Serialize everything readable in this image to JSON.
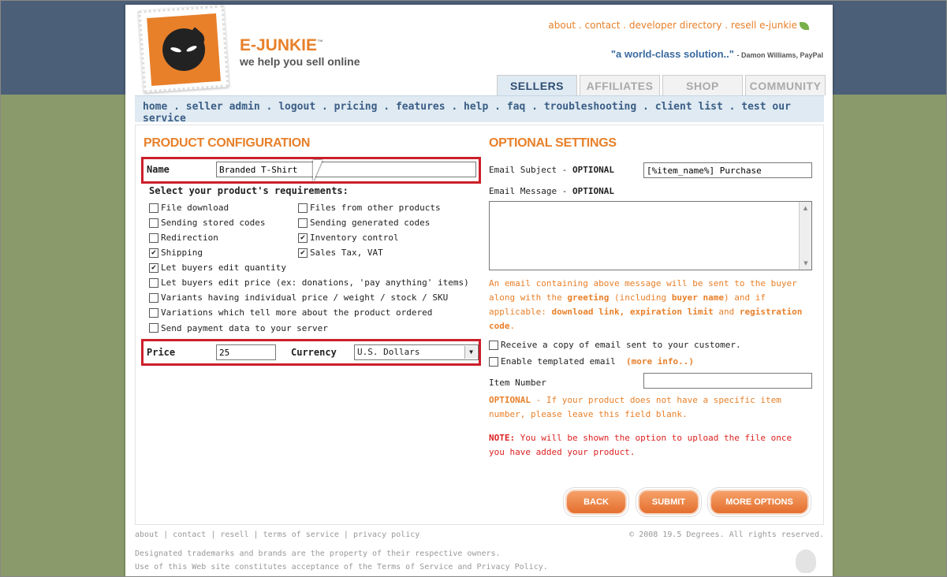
{
  "header": {
    "brand": "E-JUNKIE",
    "trademark": "™",
    "tagline": "we help you sell online",
    "top_links": [
      "about",
      "contact",
      "developer directory",
      "resell e-junkie"
    ],
    "quote": "\"a world-class solution..\"",
    "quote_author": "- Damon Williams, PayPal",
    "tabs": [
      "SELLERS",
      "AFFILIATES",
      "SHOP",
      "COMMUNITY"
    ],
    "active_tab": "SELLERS"
  },
  "nav": {
    "items": [
      "home",
      "seller admin",
      "logout",
      "pricing",
      "features",
      "help",
      "faq",
      "troubleshooting",
      "client list",
      "test our service"
    ]
  },
  "product_config": {
    "title": "PRODUCT CONFIGURATION",
    "name_label": "Name",
    "name_value": "Branded T-Shirt",
    "requirements_title": "Select your product's requirements:",
    "options": [
      {
        "label": "File download",
        "checked": false
      },
      {
        "label": "Files from other products",
        "checked": false
      },
      {
        "label": "Sending stored codes",
        "checked": false
      },
      {
        "label": "Sending generated codes",
        "checked": false
      },
      {
        "label": "Redirection",
        "checked": false
      },
      {
        "label": "Inventory control",
        "checked": true
      },
      {
        "label": "Shipping",
        "checked": true
      },
      {
        "label": "Sales Tax, VAT",
        "checked": true
      },
      {
        "label": "Let buyers edit quantity",
        "checked": true
      },
      {
        "label": "Let buyers edit price (ex: donations, 'pay anything' items)",
        "checked": false
      },
      {
        "label": "Variants having individual price / weight / stock / SKU",
        "checked": false
      },
      {
        "label": "Variations which tell more about the product ordered",
        "checked": false
      },
      {
        "label": "Send payment data to your server",
        "checked": false
      }
    ],
    "price_label": "Price",
    "price_value": "25",
    "currency_label": "Currency",
    "currency_value": "U.S. Dollars"
  },
  "optional_settings": {
    "title": "OPTIONAL SETTINGS",
    "email_subject_label": "Email Subject - ",
    "email_subject_optional": "OPTIONAL",
    "email_subject_value": "[%item_name%] Purchase",
    "email_message_label": "Email Message - ",
    "email_message_optional": "OPTIONAL",
    "email_message_value": "",
    "info_text_1": "An email containing above message will be sent to the buyer along with the ",
    "info_greeting": "greeting",
    "info_text_2": " (including ",
    "info_buyer_name": "buyer name",
    "info_text_3": ") and if applicable: ",
    "info_download": "download link, expiration limit",
    "info_text_4": " and ",
    "info_registration": "registration code",
    "info_text_5": ".",
    "receive_copy_label": "Receive a copy of email sent to your customer.",
    "templated_label": "Enable templated email",
    "more_info": "(more info..)",
    "item_number_label": "Item Number",
    "item_number_value": "",
    "optional_note_bold": "OPTIONAL",
    "optional_note": " - If your product does not have a specific item number, please leave this field blank.",
    "note_bold": "NOTE:",
    "note_text": " You will be shown the option to upload the file once you have added your product."
  },
  "buttons": {
    "back": "BACK",
    "submit": "SUBMIT",
    "more_options": "MORE OPTIONS"
  },
  "footer": {
    "links": [
      "about",
      "contact",
      "resell",
      "terms of service",
      "privacy policy"
    ],
    "copyright": "© 2008 19.5 Degrees. All rights reserved.",
    "trademark_text": "Designated trademarks and brands are the property of their respective owners.",
    "terms_text": "Use of this Web site constitutes acceptance of the Terms of Service and Privacy Policy."
  },
  "colors": {
    "accent": "#e8802a",
    "highlight": "#cc1f2a",
    "nav_text": "#3b5e86"
  }
}
